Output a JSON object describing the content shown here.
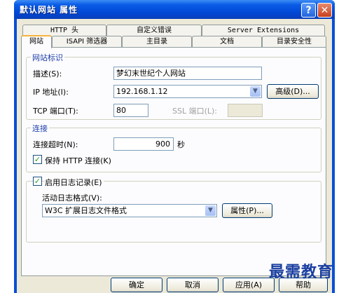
{
  "window": {
    "title": "默认网站 属性",
    "help_glyph": "?",
    "close_glyph": "✕"
  },
  "tabs_row1": [
    {
      "label": "HTTP 头"
    },
    {
      "label": "自定义错误"
    },
    {
      "label": "Server Extensions"
    }
  ],
  "tabs_row2": [
    {
      "label": "网站",
      "active": true
    },
    {
      "label": "ISAPI 筛选器"
    },
    {
      "label": "主目录"
    },
    {
      "label": "文档"
    },
    {
      "label": "目录安全性"
    }
  ],
  "site_id": {
    "title": "网站标识",
    "description_label": "描述(S):",
    "description_value": "梦幻末世纪个人网站",
    "ip_label": "IP 地址(I):",
    "ip_value": "192.168.1.12",
    "advanced_button": "高级(D)...",
    "tcp_label": "TCP 端口(T):",
    "tcp_value": "80",
    "ssl_label": "SSL 端口(L):",
    "ssl_value": ""
  },
  "connection": {
    "title": "连接",
    "timeout_label": "连接超时(N):",
    "timeout_value": "900",
    "timeout_unit": "秒",
    "keepalive_label": "保持 HTTP 连接(K)",
    "keepalive_checked": true
  },
  "logging": {
    "enable_label": "启用日志记录(E)",
    "enable_checked": true,
    "format_label": "活动日志格式(V):",
    "format_value": "W3C 扩展日志文件格式",
    "properties_button": "属性(P)..."
  },
  "buttons": {
    "ok": "确定",
    "cancel": "取消",
    "apply": "应用(A)",
    "help": "帮助"
  },
  "watermark": {
    "text": "最需教育"
  },
  "colors": {
    "titlebar": "#0a4fd6",
    "dialog_bg": "#ece9d8",
    "group_title": "#1f3fa8",
    "active_tab_accent": "#f7b33e"
  },
  "icons": {
    "dropdown": "chevron-down-icon",
    "check": "checkmark-icon"
  }
}
